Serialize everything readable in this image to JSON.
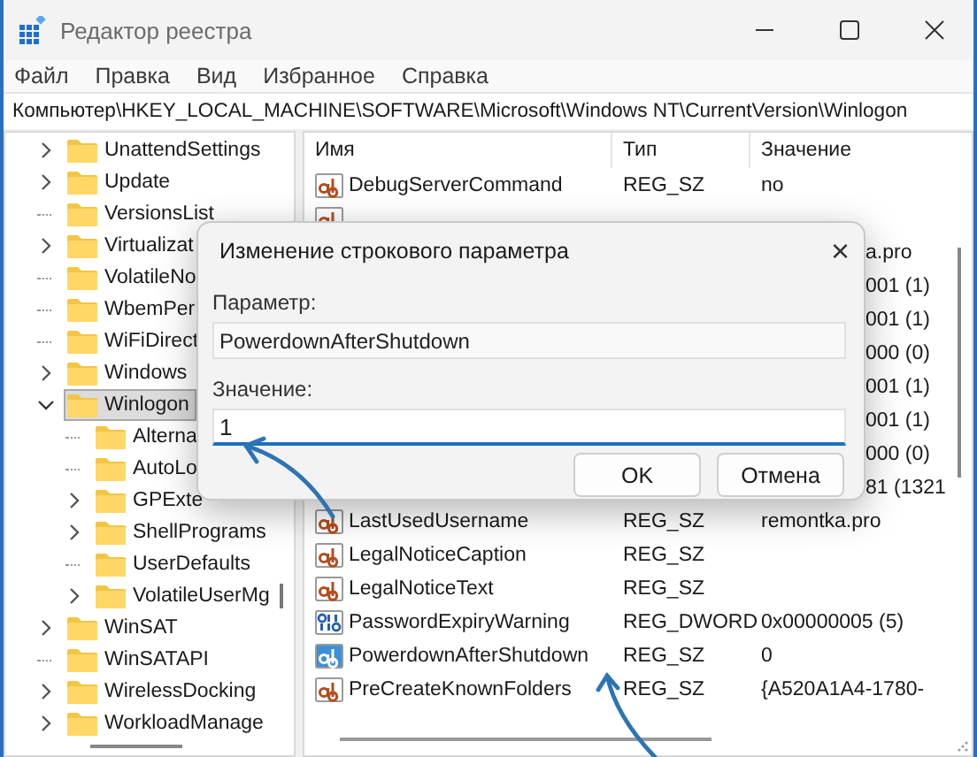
{
  "window": {
    "title": "Редактор реестра"
  },
  "menu": [
    "Файл",
    "Правка",
    "Вид",
    "Избранное",
    "Справка"
  ],
  "address": "Компьютер\\HKEY_LOCAL_MACHINE\\SOFTWARE\\Microsoft\\Windows NT\\CurrentVersion\\Winlogon",
  "tree": [
    {
      "label": "UnattendSettings",
      "kind": "branch",
      "expanded": false,
      "selected": false
    },
    {
      "label": "Update",
      "kind": "branch",
      "expanded": false,
      "selected": false
    },
    {
      "label": "VersionsList",
      "kind": "leaf",
      "selected": false
    },
    {
      "label": "Virtualizat",
      "kind": "branch",
      "expanded": false,
      "selected": false
    },
    {
      "label": "VolatileNo",
      "kind": "leaf",
      "selected": false
    },
    {
      "label": "WbemPer",
      "kind": "leaf",
      "selected": false
    },
    {
      "label": "WiFiDirect",
      "kind": "leaf",
      "selected": false
    },
    {
      "label": "Windows",
      "kind": "branch",
      "expanded": false,
      "selected": false
    },
    {
      "label": "Winlogon",
      "kind": "branch",
      "expanded": true,
      "selected": true,
      "children": [
        {
          "label": "Alterna",
          "kind": "leaf",
          "selected": false
        },
        {
          "label": "AutoLo",
          "kind": "leaf",
          "selected": false
        },
        {
          "label": "GPExte",
          "kind": "branch",
          "expanded": false,
          "selected": false
        },
        {
          "label": "ShellPrograms",
          "kind": "branch",
          "expanded": false,
          "selected": false
        },
        {
          "label": "UserDefaults",
          "kind": "leaf",
          "selected": false
        },
        {
          "label": "VolatileUserMg",
          "kind": "branch",
          "expanded": false,
          "selected": false
        }
      ]
    },
    {
      "label": "WinSAT",
      "kind": "branch",
      "expanded": false,
      "selected": false
    },
    {
      "label": "WinSATAPI",
      "kind": "leaf",
      "selected": false
    },
    {
      "label": "WirelessDocking",
      "kind": "branch",
      "expanded": false,
      "selected": false
    },
    {
      "label": "WorkloadManage",
      "kind": "branch",
      "expanded": false,
      "selected": false
    }
  ],
  "table": {
    "columns": [
      "Имя",
      "Тип",
      "Значение"
    ],
    "rows": [
      {
        "kind": "string",
        "name": "DebugServerCommand",
        "type": "REG_SZ",
        "value": "no",
        "selected": false
      },
      {
        "kind": "string"
      },
      {
        "value": "a.pro"
      },
      {
        "value": "001 (1)"
      },
      {
        "value": "001 (1)"
      },
      {
        "value": "000 (0)"
      },
      {
        "value": "001 (1)"
      },
      {
        "value": "001 (1)"
      },
      {
        "value": "000 (0)"
      },
      {
        "value": "81 (1321"
      },
      {
        "kind": "string",
        "name": "LastUsedUsername",
        "type": "REG_SZ",
        "value": "remontka.pro",
        "selected": false
      },
      {
        "kind": "string",
        "name": "LegalNoticeCaption",
        "type": "REG_SZ",
        "selected": false
      },
      {
        "kind": "string",
        "name": "LegalNoticeText",
        "type": "REG_SZ",
        "selected": false
      },
      {
        "kind": "dword",
        "name": "PasswordExpiryWarning",
        "type": "REG_DWORD",
        "value": "0x00000005 (5)",
        "selected": false
      },
      {
        "kind": "string",
        "name": "PowerdownAfterShutdown",
        "type": "REG_SZ",
        "value": "0",
        "selected": true
      },
      {
        "kind": "string",
        "name": "PreCreateKnownFolders",
        "type": "REG_SZ",
        "value": "{A520A1A4-1780-",
        "selected": false
      }
    ]
  },
  "dialog": {
    "title": "Изменение строкового параметра",
    "close": "×",
    "param_label": "Параметр:",
    "param_value": "PowerdownAfterShutdown",
    "value_label": "Значение:",
    "value": "1",
    "buttons": [
      "OK",
      "Отмена"
    ]
  }
}
